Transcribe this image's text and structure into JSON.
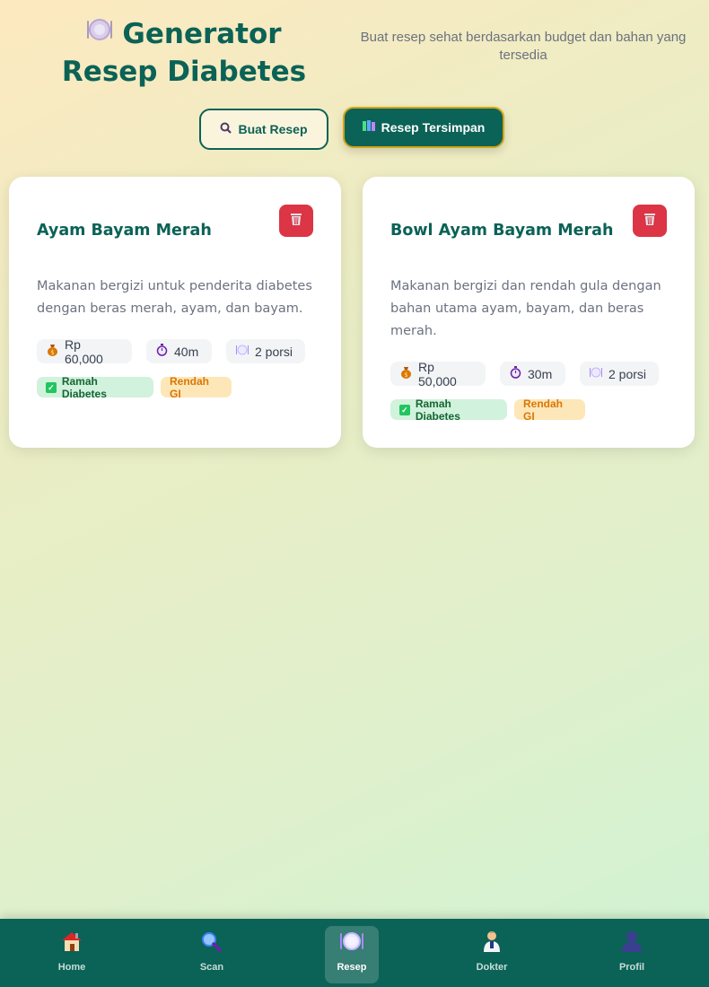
{
  "header": {
    "title_icon": "plate-icon",
    "title": "Generator Resep Diabetes",
    "subtitle": "Buat resep sehat berdasarkan budget dan bahan yang tersedia"
  },
  "tabs": [
    {
      "label": "Buat Resep",
      "icon": "magnifier-icon",
      "active": false
    },
    {
      "label": "Resep Tersimpan",
      "icon": "books-icon",
      "active": true
    }
  ],
  "recipes": [
    {
      "title": "Ayam Bayam Merah",
      "description": "Makanan bergizi untuk penderita diabetes dengan beras merah, ayam, dan bayam.",
      "cost": "Rp 60,000",
      "time": "40m",
      "portion": "2 porsi",
      "badges": [
        "Ramah Diabetes",
        "Rendah GI"
      ]
    },
    {
      "title": "Bowl Ayam Bayam Merah",
      "description": "Makanan bergizi dan rendah gula dengan bahan utama ayam, bayam, dan beras merah.",
      "cost": "Rp 50,000",
      "time": "30m",
      "portion": "2 porsi",
      "badges": [
        "Ramah Diabetes",
        "Rendah GI"
      ]
    }
  ],
  "bottom_nav": [
    {
      "label": "Home",
      "icon": "house-icon",
      "active": false
    },
    {
      "label": "Scan",
      "icon": "magnifier-icon",
      "active": false
    },
    {
      "label": "Resep",
      "icon": "plate-icon",
      "active": true
    },
    {
      "label": "Dokter",
      "icon": "doctor-icon",
      "active": false
    },
    {
      "label": "Profil",
      "icon": "person-icon",
      "active": false
    }
  ],
  "colors": {
    "primary": "#0b6256",
    "accent_border": "#d4a418",
    "delete": "#dc3545",
    "badge_green_bg": "#d1f2dc",
    "badge_orange_bg": "#fde7b8"
  }
}
